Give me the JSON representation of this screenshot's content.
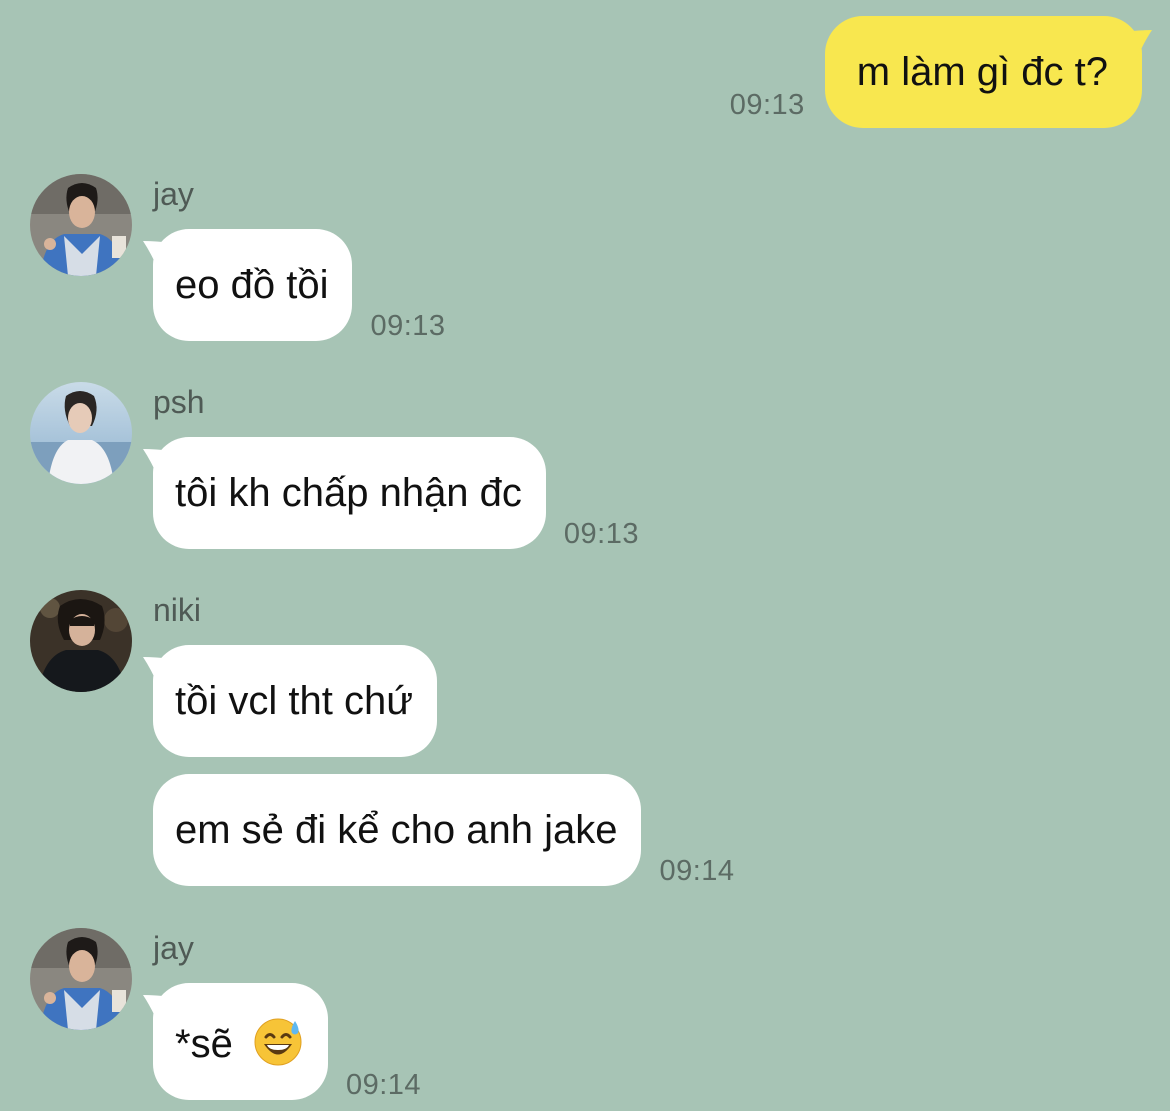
{
  "outgoing": {
    "text": "m làm gì đc t?",
    "time": "09:13",
    "color": "#f8e74f"
  },
  "groups": [
    {
      "sender": "jay",
      "avatar": "avatar-jay",
      "messages": [
        {
          "text": "eo đồ tồi",
          "time": "09:13"
        }
      ]
    },
    {
      "sender": "psh",
      "avatar": "avatar-psh",
      "messages": [
        {
          "text": "tôi kh chấp nhận đc",
          "time": "09:13"
        }
      ]
    },
    {
      "sender": "niki",
      "avatar": "avatar-niki",
      "messages": [
        {
          "text": "tồi vcl tht chứ",
          "time": ""
        },
        {
          "text": "em sẻ đi kể cho anh jake",
          "time": "09:14"
        }
      ]
    },
    {
      "sender": "jay",
      "avatar": "avatar-jay",
      "messages": [
        {
          "text": "*sẽ",
          "emoji": "sweat-smile-emoji",
          "time": "09:14"
        }
      ]
    }
  ],
  "theme": {
    "background": "#a7c4b5",
    "incoming_bubble": "#ffffff",
    "timestamp": "#5c6b64"
  }
}
